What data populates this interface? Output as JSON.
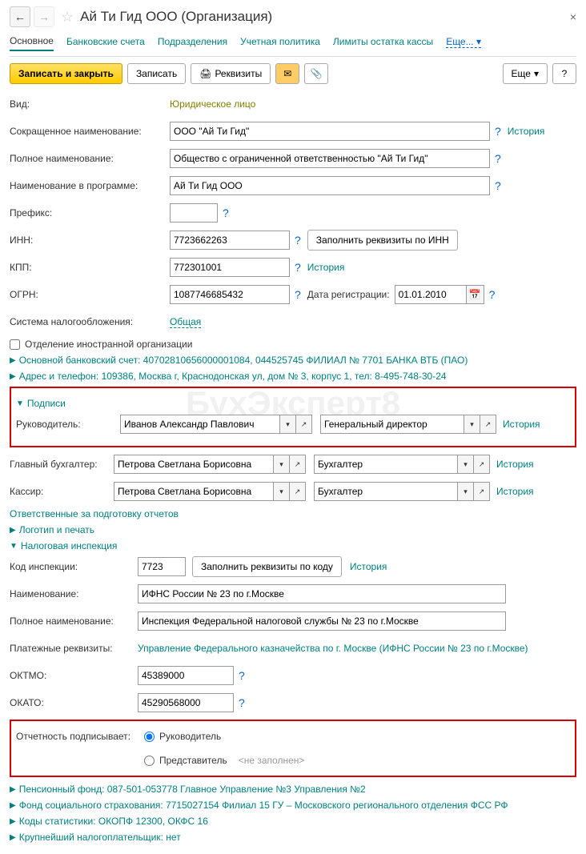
{
  "header": {
    "title": "Ай Ти Гид ООО (Организация)"
  },
  "tabs": {
    "main": "Основное",
    "bank": "Банковские счета",
    "dept": "Подразделения",
    "policy": "Учетная политика",
    "limits": "Лимиты остатка кассы",
    "more": "Еще..."
  },
  "toolbar": {
    "save_close": "Записать и закрыть",
    "save": "Записать",
    "requisites": "Реквизиты",
    "more": "Еще"
  },
  "form": {
    "kind_label": "Вид:",
    "kind_value": "Юридическое лицо",
    "short_name_label": "Сокращенное наименование:",
    "short_name_value": "ООО \"Ай Ти Гид\"",
    "full_name_label": "Полное наименование:",
    "full_name_value": "Общество с ограниченной ответственностью \"Ай Ти Гид\"",
    "prog_name_label": "Наименование в программе:",
    "prog_name_value": "Ай Ти Гид ООО",
    "prefix_label": "Префикс:",
    "prefix_value": "",
    "inn_label": "ИНН:",
    "inn_value": "7723662263",
    "fill_by_inn": "Заполнить реквизиты по ИНН",
    "kpp_label": "КПП:",
    "kpp_value": "772301001",
    "ogrn_label": "ОГРН:",
    "ogrn_value": "1087746685432",
    "reg_date_label": "Дата регистрации:",
    "reg_date_value": "01.01.2010",
    "tax_system_label": "Система налогообложения:",
    "tax_system_value": "Общая",
    "foreign_branch": "Отделение иностранной организации",
    "bank_account": "Основной банковский счет: 40702810656000001084, 044525745 ФИЛИАЛ № 7701 БАНКА ВТБ (ПАО)",
    "address_phone": "Адрес и телефон: 109386, Москва г, Краснодонская ул, дом № 3, корпус 1, тел: 8-495-748-30-24",
    "history": "История"
  },
  "signatures": {
    "section": "Подписи",
    "head_label": "Руководитель:",
    "head_name": "Иванов Александр Павлович",
    "head_pos": "Генеральный директор",
    "accountant_label": "Главный бухгалтер:",
    "accountant_name": "Петрова Светлана Борисовна",
    "accountant_pos": "Бухгалтер",
    "cashier_label": "Кассир:",
    "cashier_name": "Петрова Светлана Борисовна",
    "cashier_pos": "Бухгалтер",
    "responsible": "Ответственные за подготовку отчетов"
  },
  "logo_section": "Логотип и печать",
  "tax_inspection": {
    "section": "Налоговая инспекция",
    "code_label": "Код инспекции:",
    "code_value": "7723",
    "fill_by_code": "Заполнить реквизиты по коду",
    "name_label": "Наименование:",
    "name_value": "ИФНС России № 23 по г.Москве",
    "full_name_label": "Полное наименование:",
    "full_name_value": "Инспекция Федеральной налоговой службы № 23 по г.Москве",
    "payment_details_label": "Платежные реквизиты:",
    "payment_details_value": "Управление Федерального казначейства по г. Москве (ИФНС России № 23 по г.Москве)",
    "oktmo_label": "ОКТМО:",
    "oktmo_value": "45389000",
    "okato_label": "ОКАТО:",
    "okato_value": "45290568000",
    "signer_label": "Отчетность подписывает:",
    "signer_head": "Руководитель",
    "signer_rep": "Представитель",
    "not_filled": "<не заполнен>"
  },
  "bottom": {
    "pension": "Пенсионный фонд: 087-501-053778 Главное Управление №3 Управления №2",
    "fss": "Фонд социального страхования: 7715027154 Филиал 15 ГУ – Московского регионального отделения ФСС РФ",
    "stat": "Коды статистики: ОКОПФ 12300, ОКФС 16",
    "largest": "Крупнейший налогоплательщик: нет"
  }
}
